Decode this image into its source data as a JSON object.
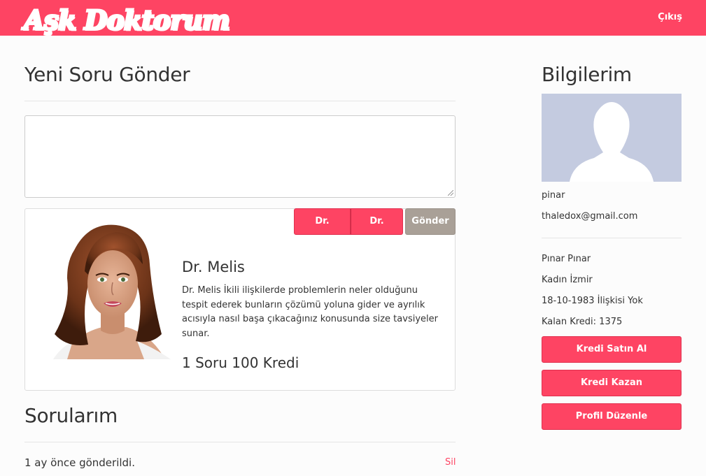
{
  "header": {
    "brand": "Aşk Doktorum",
    "logout_label": "Çıkış"
  },
  "new_question": {
    "title": "Yeni Soru Gönder",
    "textarea_value": "",
    "doctor_tabs": [
      "Dr. Melis",
      "Dr. Bora"
    ],
    "send_label": "Gönder"
  },
  "doctor": {
    "name": "Dr. Melis",
    "description": "Dr. Melis İkili ilişkilerde problemlerin neler olduğunu tespit ederek bunların çözümü yoluna gider ve ayrılık acısıyla nasıl başa çıkacağınız konusunda size tavsiyeler sunar.",
    "price": "1 Soru 100 Kredi"
  },
  "my_questions": {
    "title": "Sorularım",
    "items": [
      {
        "sent": "1 ay önce gönderildi.",
        "delete_label": "Sil"
      }
    ]
  },
  "profile": {
    "title": "Bilgilerim",
    "username": "pinar",
    "email": "thaledox@gmail.com",
    "full_name": "Pınar Pınar",
    "gender_city": "Kadın İzmir",
    "birth_status": "18-10-1983 İlişkisi Yok",
    "credit": "Kalan Kredi: 1375",
    "buttons": [
      "Kredi Satın Al",
      "Kredi Kazan",
      "Profil Düzenle"
    ]
  },
  "colors": {
    "brand": "#fe4463",
    "send_button": "#a9a097",
    "profile_placeholder": "#c4cbe0"
  }
}
